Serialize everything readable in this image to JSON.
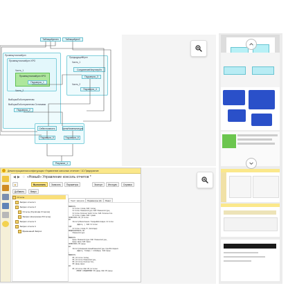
{
  "viewer": {
    "zoom_icon": "zoom-in-icon",
    "nav_up_icon": "chevron-up-icon",
    "nav_down_icon": "chevron-down-icon"
  },
  "diagram": {
    "tables": [
      "ТаблицаКуплен",
      "ТаблицаКупл2"
    ],
    "left_group": "ПромежуточнаяКупл",
    "left_sub": "ПромежуточнаяКупл ХРО",
    "left_inner": "Часть_1",
    "left_green": "ПромежуточнаяКупл ХРО",
    "left_green_node": "Подзапрос_1",
    "left_part2": "Часть_2",
    "left_bottom1": "ВыборкаПоКонтрагентам",
    "left_bottom2": "ВыборкаПоКонтрагентам Остатками",
    "left_bottom_node": "Подзапрос_2",
    "right_group": "ПредыдущийКупл",
    "right_part1": "Часть_1",
    "right_inner": "СоединениеИзнутсерИз",
    "right_node": "Подзапрос_3",
    "right_part2": "Часть_2",
    "right_node2": "Подзапрос_4",
    "bottom_left": "Себестоимость",
    "bottom_left2": "Подзапрос_5",
    "bottom_right": "ЦеныНоменклатуры",
    "bottom_right2": "Подзапрос_6",
    "result": "Результат_1"
  },
  "app": {
    "window_title": "Демонстрационная конфигурация «Управление консолью отчетов» / 1С:Предприятие",
    "form_title": "«Новый»  Управление консоль отчетов *",
    "buttons": {
      "run": "Выполнить",
      "save": "Записать",
      "query": "Запрос",
      "settings": "Параметры",
      "export": "Экспорт",
      "tools": "Инструм.",
      "help": "Справка"
    },
    "left_toolbar_buttons": [
      "Добавить",
      "Вверх"
    ],
    "tree": [
      "Отчеты",
      "Запрос отчета 1",
      "Запрос отчета 2",
      "Отчеты (Группова Отчетов)",
      "Запрос (Контрагент/Отчеты)",
      "Запрос отчета 3",
      "Запрос отчета 4",
      "Временный Запрос"
    ],
    "tabs": [
      "Текст запроса",
      "Параметры (0)",
      "Пакет"
    ],
    "code_lines": [
      "ВЫБРАТЬ",
      "    Остатки.Склад КАК Склад,",
      "    Остатки.Номенклатура КАК Номенклатура,",
      "    Остатки.КоличествоОстаток КАК Количество",
      "    Остатки.Сумма КАК Сумма",
      "ПОМЕСТИТЬ ВТ_Остатки",
      "ИЗ",
      "    РегистрНакопления.ТоварыНаСкладах.Остатки",
      "        (&Дата, ) КАК Остатки",
      "ГДЕ",
      "    Остатки.Склад В (&Склады)",
      "",
      "ИНДЕКСИРОВАТЬ ПО",
      "    Номенклатура",
      ";",
      "",
      "ВЫБРАТЬ",
      "    Цены.Номенклатура КАК Номенклатура,",
      "    Цены.Цена КАК Цена",
      "ПОМЕСТИТЬ ВТ_Цены",
      "ИЗ",
      "    РегистрСведений.ЦеныНоменклатуры.СрезПоследних",
      "        (&Дата, ТипЦен = &ТипЦен) КАК Цены",
      ";",
      "",
      "ВЫБРАТЬ",
      "    ВТ_Остатки.Склад,",
      "    ВТ_Остатки.Номенклатура,",
      "    ВТ_Остатки.Количество,",
      "    ВТ_Цены.Цена",
      "ИЗ",
      "    ВТ_Остатки КАК ВТ_Остатки",
      "        ЛЕВОЕ СОЕДИНЕНИЕ ВТ_Цены КАК ВТ_Цены"
    ]
  },
  "colors": {
    "diagram_border": "#7fcfdc",
    "node_fill": "#dff6fa",
    "green_node": "#aee79d",
    "titlebar": "#fbe88b",
    "selection": "#f9df7a"
  }
}
